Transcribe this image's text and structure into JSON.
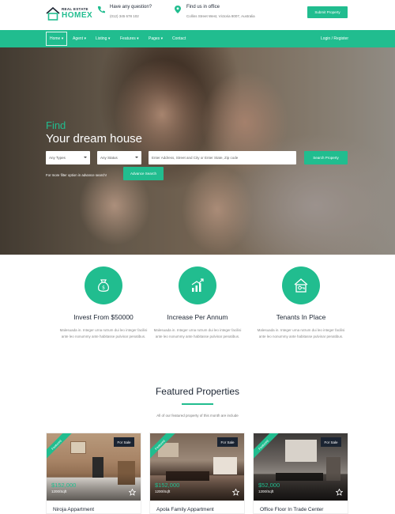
{
  "brand": {
    "small": "REAL ESTATE",
    "big": "HOMEX"
  },
  "contact": [
    {
      "icon": "phone-icon",
      "title": "Have any question?",
      "detail": "(012) 345 678 102"
    },
    {
      "icon": "location-pin-icon",
      "title": "Find us in office",
      "detail": "Collins Street West, Victoria 8007, Australia"
    }
  ],
  "submit_button": "Submit Property",
  "nav": {
    "items": [
      "Home",
      "Agent",
      "Listing",
      "Features",
      "Pages",
      "Contact"
    ],
    "login": "Login / Register"
  },
  "hero": {
    "find": "Find",
    "title": "Your dream house",
    "type_select": "Any Types",
    "status_select": "Any Status",
    "address_placeholder": "Enter Address, Street and City or Enter State, Zip code",
    "search_button": "Search Property",
    "filter_text": "For more filter option in advance search!",
    "advance_button": "Advance Search"
  },
  "features": [
    {
      "icon": "money-bag-icon",
      "title": "Invest From $50000",
      "desc": "Malesuada in. Integer urna rutrum dui leo integer facilisi ante leo nonummy ante habitasse pulvinar penatibus."
    },
    {
      "icon": "growth-chart-icon",
      "title": "Increase Per Annum",
      "desc": "Malesuada in. Integer urna rutrum dui leo integer facilisi ante leo nonummy ante habitasse pulvinar penatibus."
    },
    {
      "icon": "house-key-icon",
      "title": "Tenants In Place",
      "desc": "Malesuada in. Integer urna rutrum dui leo integer facilisi ante leo nonummy ante habitasse pulvinar penatibus."
    }
  ],
  "featured": {
    "title": "Featured Properties",
    "subtitle": "All of our featured property of this month are include"
  },
  "cards": [
    {
      "ribbon": "Featured",
      "badge": "For Sale",
      "price": "$152,000",
      "sqft": "1200/Sqft",
      "name": "Niroja Appartment"
    },
    {
      "ribbon": "Featured",
      "badge": "For Sale",
      "price": "$152,000",
      "sqft": "1200/Sqft",
      "name": "Apola Family Appartment"
    },
    {
      "ribbon": "Featured",
      "badge": "For Sale",
      "price": "$52,000",
      "sqft": "1200/Sqft",
      "name": "Office Floor In Trade Center"
    }
  ],
  "colors": {
    "accent": "#21bd8f",
    "dark": "#1b2432"
  }
}
